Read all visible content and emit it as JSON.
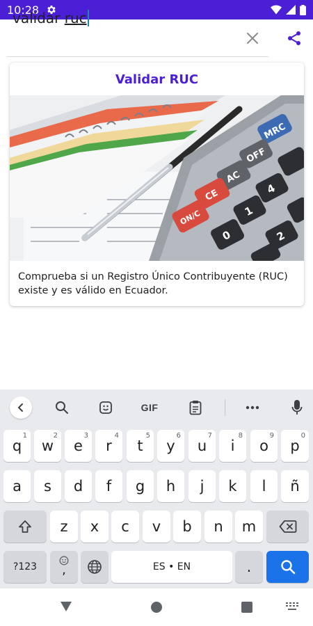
{
  "status_bar": {
    "time": "10:28",
    "background_color": "#4a1fd6",
    "icons": [
      "gear-icon",
      "wifi-icon",
      "signal-icon",
      "battery-icon"
    ]
  },
  "search": {
    "prefix": "validar ",
    "typed": "ruc",
    "clear_icon": "close-icon",
    "share_icon": "share-icon"
  },
  "result_card": {
    "title": "Validar RUC",
    "image": "calculator-and-pen-photo",
    "description": "Comprueba si un Registro Único Contribuyente (RUC) existe y es válido en Ecuador.",
    "accent_color": "#4a1fd6"
  },
  "keyboard": {
    "toolbar": {
      "back_icon": "chevron-left-icon",
      "search_icon": "search-icon",
      "sticker_icon": "sticker-icon",
      "gif_label": "GIF",
      "clipboard_icon": "clipboard-icon",
      "more_icon": "more-icon",
      "mic_icon": "mic-icon"
    },
    "row1": [
      {
        "key": "q",
        "hint": "1"
      },
      {
        "key": "w",
        "hint": "2"
      },
      {
        "key": "e",
        "hint": "3"
      },
      {
        "key": "r",
        "hint": "4"
      },
      {
        "key": "t",
        "hint": "5"
      },
      {
        "key": "y",
        "hint": "6"
      },
      {
        "key": "u",
        "hint": "7"
      },
      {
        "key": "i",
        "hint": "8"
      },
      {
        "key": "o",
        "hint": "9"
      },
      {
        "key": "p",
        "hint": "0"
      }
    ],
    "row2": [
      "a",
      "s",
      "d",
      "f",
      "g",
      "h",
      "j",
      "k",
      "l",
      "ñ"
    ],
    "row3": [
      "z",
      "x",
      "c",
      "v",
      "b",
      "n",
      "m"
    ],
    "symbols_label": "?123",
    "comma_label": ",",
    "space_label": "ES • EN",
    "period_label": ".",
    "enter_color": "#1a73e8"
  },
  "nav_bar": {
    "icons": [
      "back-triangle-icon",
      "home-circle-icon",
      "recents-square-icon",
      "keyboard-switch-icon"
    ]
  }
}
